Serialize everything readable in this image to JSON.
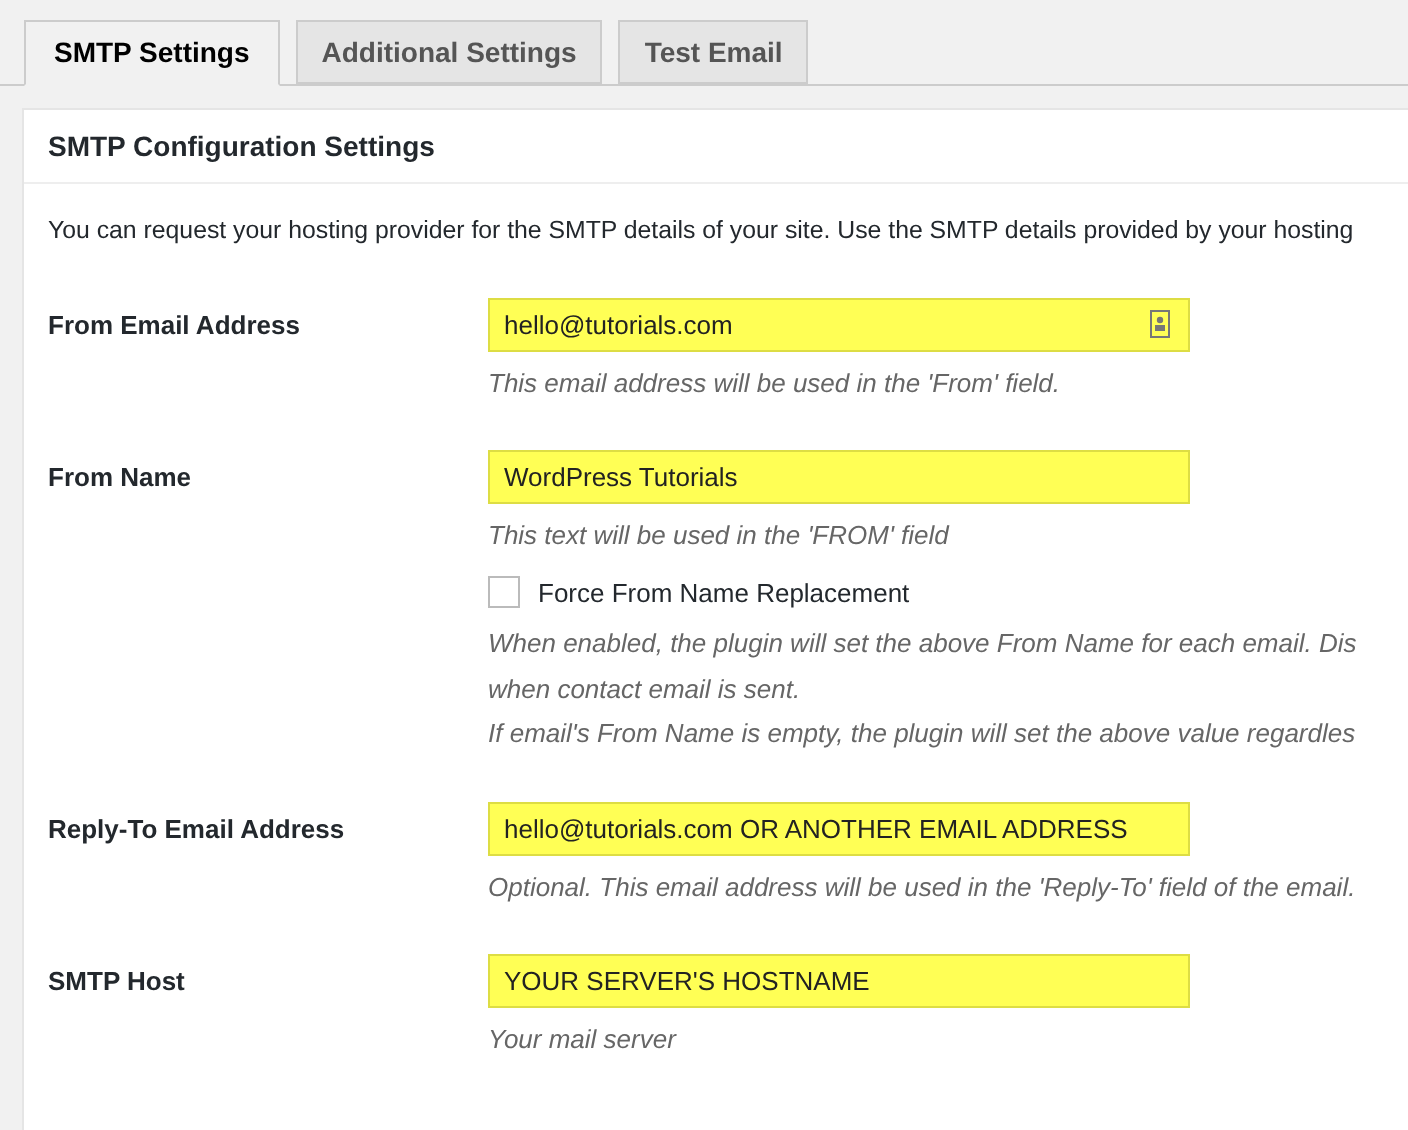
{
  "tabs": [
    {
      "label": "SMTP Settings",
      "selected": true
    },
    {
      "label": "Additional Settings",
      "selected": false
    },
    {
      "label": "Test Email",
      "selected": false
    }
  ],
  "panel": {
    "title": "SMTP Configuration Settings",
    "intro": "You can request your hosting provider for the SMTP details of your site. Use the SMTP details provided by your hosting",
    "settings": [
      {
        "label": "From Email Address",
        "value": "hello@tutorials.com",
        "autofilled": true,
        "contact_icon": true,
        "help": "This email address will be used in the 'From' field."
      },
      {
        "label": "From Name",
        "value": "WordPress Tutorials",
        "autofilled": true,
        "contact_icon": false,
        "help": "This text will be used in the 'FROM' field",
        "checkbox": {
          "label": "Force From Name Replacement",
          "checked": false
        },
        "notes": [
          "When enabled, the plugin will set the above From Name for each email. Dis",
          "when contact email is sent.",
          "If email's From Name is empty, the plugin will set the above value regardles"
        ]
      },
      {
        "label": "Reply-To Email Address",
        "value": "hello@tutorials.com OR ANOTHER EMAIL ADDRESS",
        "autofilled": true,
        "contact_icon": false,
        "help": "Optional. This email address will be used in the 'Reply-To' field of the email."
      },
      {
        "label": "SMTP Host",
        "value": "YOUR SERVER'S HOSTNAME",
        "autofilled": true,
        "contact_icon": false,
        "help": "Your mail server"
      }
    ]
  }
}
